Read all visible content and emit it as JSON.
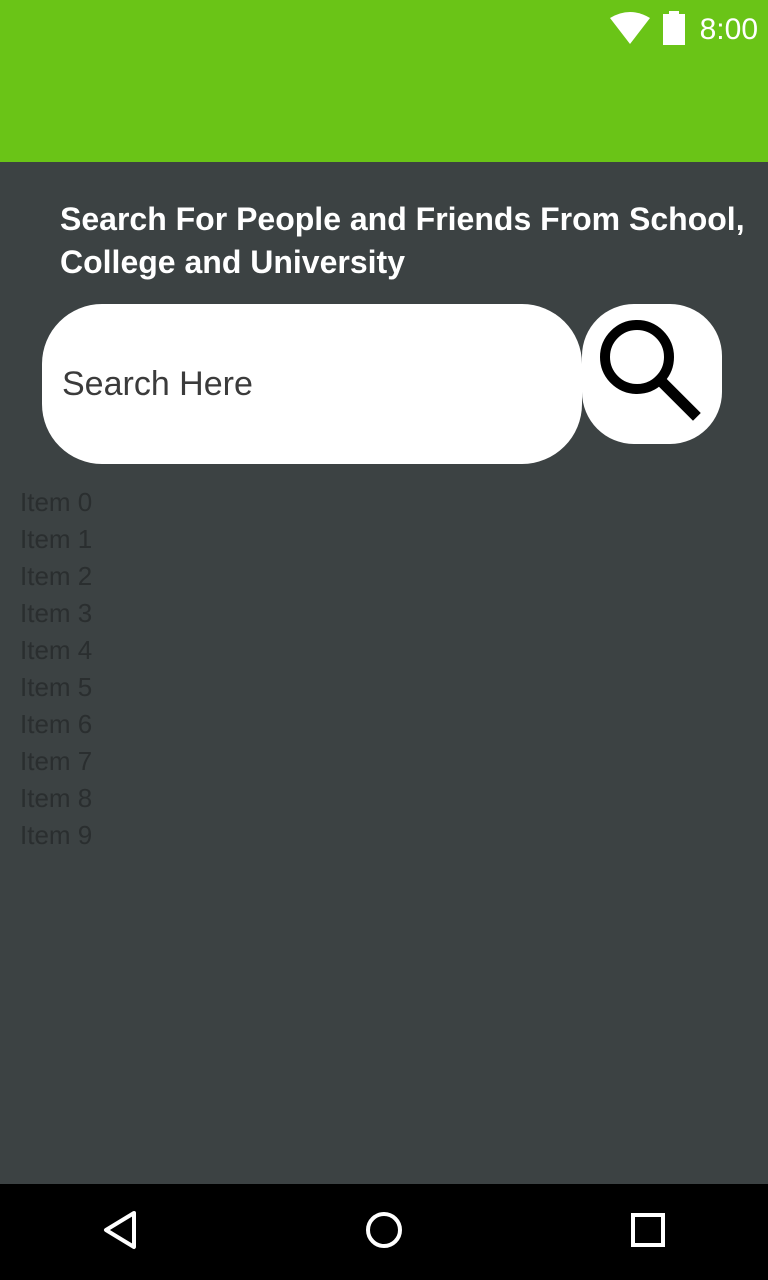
{
  "status_bar": {
    "time": "8:00",
    "background_color": "#6ac417",
    "icons": [
      "wifi-icon",
      "battery-icon"
    ]
  },
  "main": {
    "headline_line1": "Search For People and Friends From School,",
    "headline_line2": "College and University",
    "background_color": "#3c4243"
  },
  "search": {
    "placeholder": "Search Here",
    "value": "",
    "button_icon": "search-icon"
  },
  "results": {
    "items": [
      "Item 0",
      "Item 1",
      "Item 2",
      "Item 3",
      "Item 4",
      "Item 5",
      "Item 6",
      "Item 7",
      "Item 8",
      "Item 9"
    ]
  },
  "nav_bar": {
    "icons": [
      "back-icon",
      "home-icon",
      "recents-icon"
    ]
  }
}
